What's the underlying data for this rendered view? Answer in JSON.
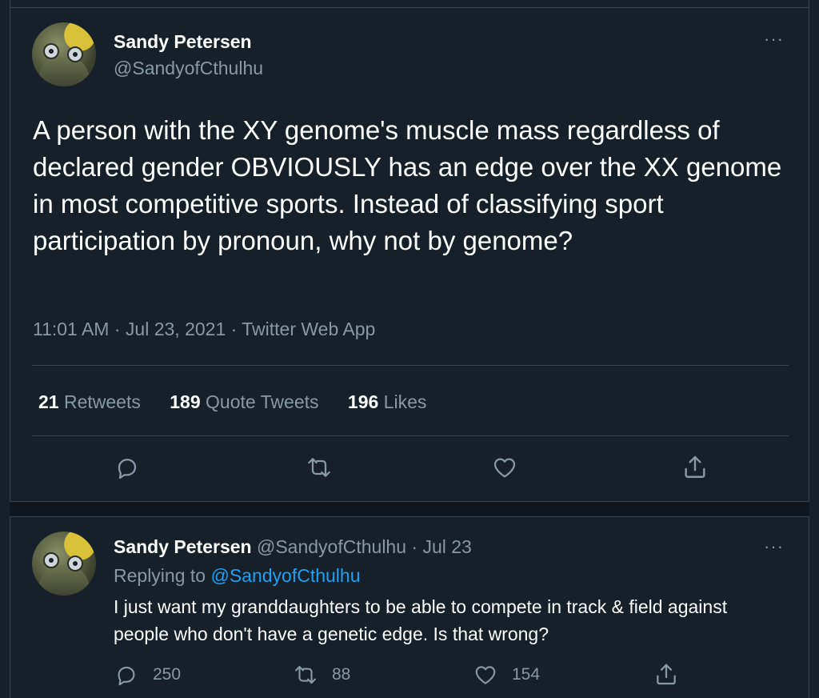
{
  "main_tweet": {
    "author_name": "Sandy Petersen",
    "author_handle": "@SandyofCthulhu",
    "text": "A person with the XY genome's muscle mass regardless of declared gender OBVIOUSLY has an edge over the XX genome in most competitive sports. Instead of classifying sport participation by pronoun, why not by genome?",
    "timestamp": "11:01 AM · Jul 23, 2021 · Twitter Web App",
    "stats": {
      "retweets_count": "21",
      "retweets_label": "Retweets",
      "quotes_count": "189",
      "quotes_label": "Quote Tweets",
      "likes_count": "196",
      "likes_label": "Likes"
    },
    "more_label": "···"
  },
  "reply_tweet": {
    "author_name": "Sandy Petersen",
    "meta": "@SandyofCthulhu · Jul 23",
    "replying_prefix": "Replying to",
    "replying_handle": "@SandyofCthulhu",
    "text": "I just want my granddaughters to be able to compete in track & field against people who don't have a genetic edge. Is that wrong?",
    "reply_count": "250",
    "retweet_count": "88",
    "like_count": "154",
    "more_label": "···"
  },
  "icons": [
    "reply-icon",
    "retweet-icon",
    "like-icon",
    "share-icon",
    "more-icon",
    "avatar"
  ],
  "colors": {
    "background": "#15202b",
    "muted": "#8899a6",
    "link": "#1da1f2",
    "divider": "#38444d"
  }
}
